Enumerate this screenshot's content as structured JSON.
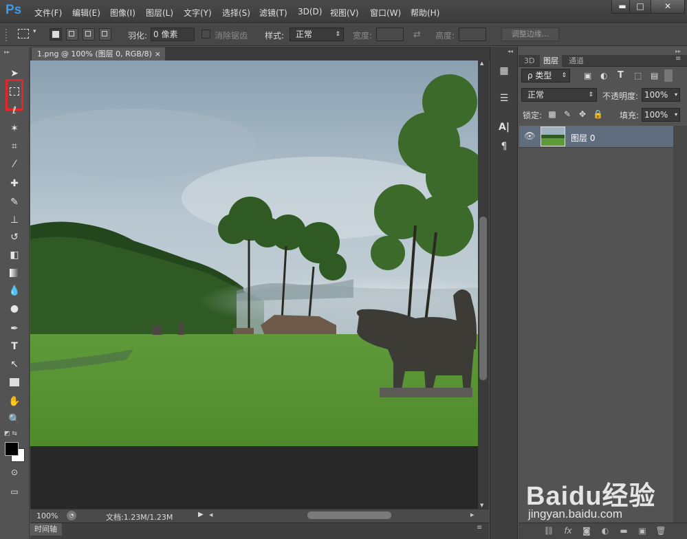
{
  "app": {
    "logo": "Ps"
  },
  "menu": [
    "文件(F)",
    "编辑(E)",
    "图像(I)",
    "图层(L)",
    "文字(Y)",
    "选择(S)",
    "滤镜(T)",
    "3D(D)",
    "视图(V)",
    "窗口(W)",
    "帮助(H)"
  ],
  "window_buttons": {
    "minimize": "▬",
    "restore": "□",
    "close": "✕"
  },
  "options": {
    "feather_label": "羽化:",
    "feather_value": "0 像素",
    "antialias_label": "消除锯齿",
    "style_label": "样式:",
    "style_value": "正常",
    "width_label": "宽度:",
    "height_label": "高度:",
    "refine_button": "调整边缘..."
  },
  "document": {
    "tab_title": "1.png @ 100% (图层 0, RGB/8)",
    "tab_close": "×",
    "zoom": "100%",
    "doc_info": "文档:1.23M/1.23M"
  },
  "timeline": {
    "label": "时间轴"
  },
  "layers_panel": {
    "tabs": [
      "3D",
      "图层",
      "通道"
    ],
    "active_tab": "图层",
    "filter_kind": "ρ 类型",
    "blend_mode": "正常",
    "opacity_label": "不透明度:",
    "opacity_value": "100%",
    "lock_label": "锁定:",
    "fill_label": "填充:",
    "fill_value": "100%",
    "layer_name": "图层 0"
  },
  "watermark": {
    "text": "Baidu经验",
    "url": "jingyan.baidu.com"
  },
  "colors": {
    "highlight": "#e8262a",
    "accent": "#3d9ae8"
  }
}
